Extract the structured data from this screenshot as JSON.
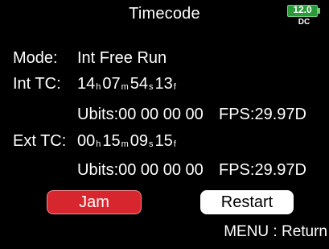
{
  "header": {
    "title": "Timecode",
    "battery": {
      "voltage": "12.0",
      "source": "DC"
    }
  },
  "mode": {
    "label": "Mode:",
    "value": "Int Free Run"
  },
  "int_tc": {
    "label": "Int TC:",
    "hours": "14",
    "h_unit": "h",
    "minutes": "07",
    "m_unit": "m",
    "seconds": "54",
    "s_unit": "s",
    "frames": "13",
    "f_unit": "f",
    "ubits": "Ubits:00 00 00 00",
    "fps": "FPS:29.97D"
  },
  "ext_tc": {
    "label": "Ext TC:",
    "hours": "00",
    "h_unit": "h",
    "minutes": "15",
    "m_unit": "m",
    "seconds": "09",
    "s_unit": "s",
    "frames": "15",
    "f_unit": "f",
    "ubits": "Ubits:00 00 00 00",
    "fps": "FPS:29.97D"
  },
  "buttons": {
    "jam": "Jam",
    "restart": "Restart"
  },
  "footer": {
    "menu_hint": "MENU : Return"
  },
  "colors": {
    "jam_button": "#d7262e",
    "battery": "#2a9a3a",
    "background": "#000000",
    "text": "#ffffff"
  }
}
